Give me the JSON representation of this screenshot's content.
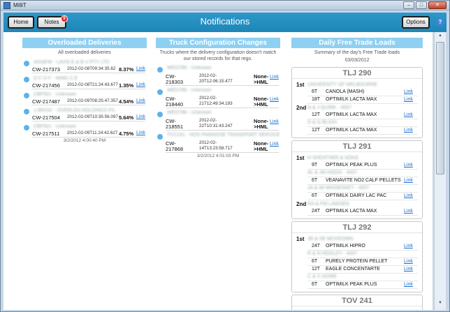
{
  "window": {
    "title": "MilliT",
    "minimize": "–",
    "maximize": "□",
    "close": "✕"
  },
  "header": {
    "title": "Notifications",
    "home_label": "Home",
    "notes_label": "Notes",
    "notes_badge": "9",
    "options_label": "Options",
    "help_label": "?"
  },
  "overloaded": {
    "title": "Overloaded Deliveries",
    "subtitle": "All overloaded deliveries",
    "rows": [
      {
        "name": "AGNEW - LAVIS E & B V PTY LTD",
        "cw": "CW-217373",
        "time": "2012-02-08T09:34:35.62",
        "pct": "8.37%",
        "link": "Link"
      },
      {
        "name": "D C D F - WMG C.E",
        "cw": "CW-217456",
        "time": "2012-02-08T21:24:43.677",
        "pct": "1.35%",
        "link": "Link"
      },
      {
        "name": "CBF501 - Unknown",
        "cw": "CW-217487",
        "time": "2012-02-09T08:25:47.357",
        "pct": "4.54%",
        "link": "Link"
      },
      {
        "name": "1-BRISC - OVERLEA HOLDINGS P/L",
        "cw": "CW-217504",
        "time": "2012-02-09T10:35:56.097",
        "pct": "5.64%",
        "link": "Link"
      },
      {
        "name": "CBF501 - Unknown",
        "cw": "CW-217511",
        "time": "2012-02-09T11:24:42.627",
        "pct": "4.75%",
        "link": "Link"
      }
    ],
    "stamp": "3/2/2012 4:00:40 PM"
  },
  "truck": {
    "title": "Truck Configuration Changes",
    "subtitle": "Trucks where the delivery configuration doesn't match our stored records for that rego.",
    "rows": [
      {
        "name": "WEO786 - Unknown",
        "cw1": "CW-",
        "cw2": "218303",
        "t1": "2012-02-",
        "t2": "20T12:06:15.477",
        "n1": "None-",
        "n2": ">HML",
        "link": "Link"
      },
      {
        "name": "WEO786 - Unknown",
        "cw1": "CW-",
        "cw2": "218440",
        "t1": "2012-02-",
        "t2": "21T12:49:34.193",
        "n1": "None-",
        "n2": ">HML",
        "link": "Link"
      },
      {
        "name": "WEO786 - Unknown",
        "cw1": "CW-",
        "cw2": "218551",
        "t1": "2012-02-",
        "t2": "22T10:31:43.247",
        "n1": "None-",
        "n2": ">HML",
        "link": "Link"
      },
      {
        "name": "TCC241 - NOS PARADISE TRANSPORT SERVICE",
        "cw1": "CW-",
        "cw2": "217868",
        "t1": "2012-02-",
        "t2": "14T13:23:58.717",
        "n1": "None-",
        "n2": ">HML",
        "link": "Link"
      }
    ],
    "stamp": "3/2/2012 4:01:03 PM"
  },
  "freetrade": {
    "title": "Daily Free Trade Loads",
    "subtitle": "Summary of the day's Free Trade loads",
    "date": "03/03/2012",
    "cards": [
      {
        "title": "TLJ 290",
        "places": [
          {
            "label": "1st",
            "name": "UNIVERSITY OF MELBOURNE",
            "items": [
              {
                "qty": "6T",
                "prod": "CANOLA (MASH)",
                "link": "Link"
              },
              {
                "qty": "18T",
                "prod": "OPTIMILK LACTA MAX",
                "link": "Link"
              }
            ]
          },
          {
            "label": "2nd",
            "name": "N & J QUIRK - 4007",
            "items": [
              {
                "qty": "12T",
                "prod": "OPTIMILK LACTA MAX",
                "link": "Link"
              },
              {
                "qty": "",
                "prod": "",
                "blur": "D & G BLIGH",
                "link": ""
              },
              {
                "qty": "12T",
                "prod": "OPTIMILK LACTA MAX",
                "link": "Link"
              }
            ]
          }
        ]
      },
      {
        "title": "TLJ 291",
        "places": [
          {
            "label": "1st",
            "name": "H SHEATHER & SONS",
            "items": [
              {
                "qty": "9T",
                "prod": "OPTIMILK PEAK PLUS",
                "link": "Link"
              },
              {
                "qty": "",
                "prod": "",
                "blur": "AL & JM HOGG - 4007",
                "link": ""
              },
              {
                "qty": "6T",
                "prod": "VEANAVITE NO2 CALF PELLETS",
                "link": "Link"
              },
              {
                "qty": "",
                "prod": "",
                "blur": "JA & IM WHORSKEY - 4007",
                "link": ""
              },
              {
                "qty": "6T",
                "prod": "OPTIMILK DAIRY LAC PAC",
                "link": "Link"
              }
            ]
          },
          {
            "label": "2nd",
            "name": "RA & PM LAWSEN",
            "items": [
              {
                "qty": "24T",
                "prod": "OPTIMILK LACTA MAX",
                "link": "Link"
              }
            ]
          }
        ]
      },
      {
        "title": "TLJ 292",
        "places": [
          {
            "label": "1st",
            "name": "JB & SE MCKEOWN",
            "items": [
              {
                "qty": "24T",
                "prod": "OPTIMILK HIPRO",
                "link": "Link"
              },
              {
                "qty": "",
                "prod": "",
                "blur": "R & N HOOLEY - 4007",
                "link": ""
              },
              {
                "qty": "6T",
                "prod": "PURELY PROTEIN PELLET",
                "link": "Link"
              },
              {
                "qty": "12T",
                "prod": "EAGLE CONCENTARTE",
                "link": "Link"
              },
              {
                "qty": "",
                "prod": "",
                "blur": "C & S HOWE",
                "link": ""
              },
              {
                "qty": "6T",
                "prod": "OPTIMILK PEAK PLUS",
                "link": "Link"
              }
            ]
          }
        ]
      },
      {
        "title": "TOV 241",
        "places": []
      }
    ]
  },
  "icons": {
    "scroll_up": "▲",
    "scroll_down": "▼"
  }
}
